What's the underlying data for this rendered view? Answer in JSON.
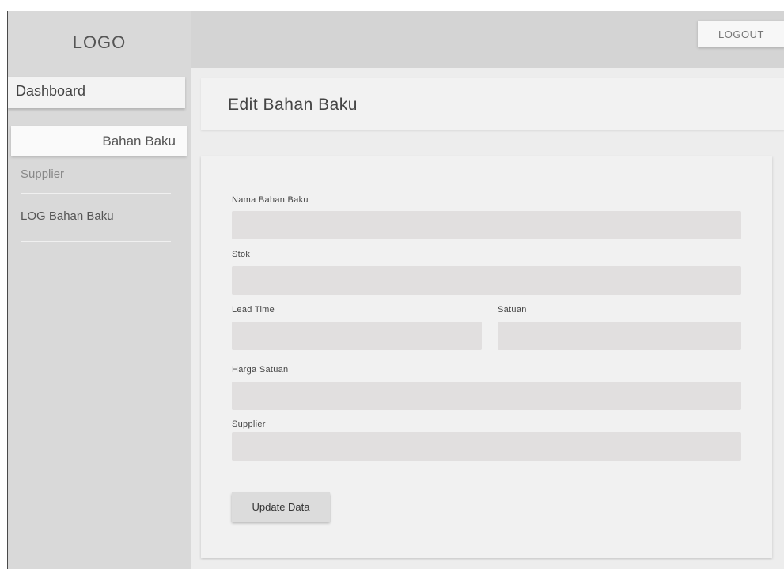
{
  "header": {
    "logout_label": "LOGOUT"
  },
  "sidebar": {
    "logo": "LOGO",
    "items": [
      {
        "label": "Dashboard"
      },
      {
        "label": "Bahan Baku"
      },
      {
        "label": "Supplier"
      },
      {
        "label": "LOG Bahan Baku"
      }
    ]
  },
  "page": {
    "title": "Edit Bahan Baku"
  },
  "form": {
    "nama_label": "Nama Bahan Baku",
    "nama_value": "",
    "stok_label": "Stok",
    "stok_value": "",
    "lead_time_label": "Lead Time",
    "lead_time_value": "",
    "satuan_label": "Satuan",
    "satuan_value": "",
    "harga_label": "Harga Satuan",
    "harga_value": "",
    "supplier_label": "Supplier",
    "supplier_value": "",
    "submit_label": "Update Data"
  }
}
